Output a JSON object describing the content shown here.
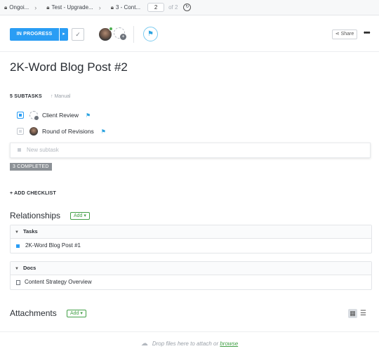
{
  "breadcrumb": {
    "items": [
      "Ongoi...",
      "Test - Upgrade...",
      "3 - Cont..."
    ],
    "page_current": "2",
    "page_total": "of 2"
  },
  "header": {
    "status_label": "IN PROGRESS",
    "share_label": "Share",
    "more_label": "•••"
  },
  "task": {
    "title": "2K-Word Blog Post #2"
  },
  "subtasks": {
    "heading": "5 SUBTASKS",
    "sort_label": "Manual",
    "items": [
      {
        "label": "Client Review"
      },
      {
        "label": "Round of Revisions"
      }
    ],
    "new_placeholder": "New subtask",
    "completed_label": "3 COMPLETED"
  },
  "checklist": {
    "add_label": "+ ADD CHECKLIST"
  },
  "relationships": {
    "title": "Relationships",
    "add_label": "Add ▾",
    "tasks_heading": "Tasks",
    "tasks": [
      "2K-Word Blog Post #1"
    ],
    "docs_heading": "Docs",
    "docs": [
      "Content Strategy Overview"
    ]
  },
  "attachments": {
    "title": "Attachments",
    "add_label": "Add ▾",
    "drop_text": "Drop files here to attach or",
    "browse_label": "browse"
  },
  "colors": {
    "accent_blue": "#2a9df4",
    "add_green": "#43a047",
    "completed_grey": "#8c9196"
  }
}
